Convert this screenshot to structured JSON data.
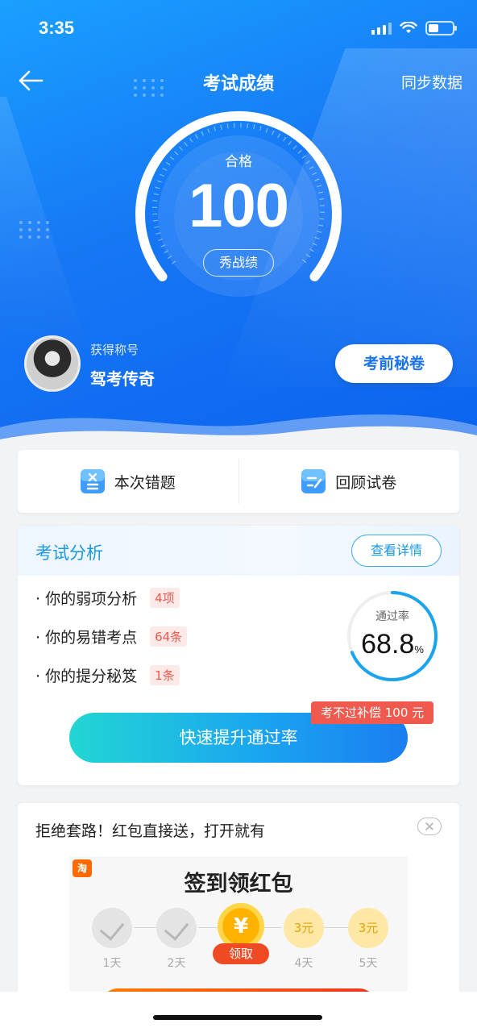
{
  "status": {
    "time": "3:35"
  },
  "nav": {
    "title": "考试成绩",
    "sync": "同步数据"
  },
  "score": {
    "level": "合格",
    "value": "100",
    "share": "秀战绩"
  },
  "user": {
    "title_label": "获得称号",
    "title_name": "驾考传奇",
    "secret_button": "考前秘卷"
  },
  "actions": [
    {
      "label": "本次错题",
      "icon": "wrong-questions-icon"
    },
    {
      "label": "回顾试卷",
      "icon": "review-paper-icon"
    }
  ],
  "analysis": {
    "title": "考试分析",
    "detail_button": "查看详情",
    "items": [
      {
        "text": "· 你的弱项分析",
        "badge": "4项"
      },
      {
        "text": "· 你的易错考点",
        "badge": "64条"
      },
      {
        "text": "· 你的提分秘笈",
        "badge": "1条"
      }
    ],
    "pass_rate_label": "通过率",
    "pass_rate": "68.8",
    "pass_rate_unit": "%",
    "pass_rate_fraction": 0.688,
    "promo_badge": "考不过补偿 100 元",
    "boost_button": "快速提升通过率"
  },
  "redpack": {
    "text": "拒绝套路！红包直接送，打开就有",
    "taobao": "淘",
    "banner_title": "签到领红包",
    "days": [
      {
        "label": "1天",
        "state": "done"
      },
      {
        "label": "2天",
        "state": "done"
      },
      {
        "label": "",
        "state": "today",
        "coin": "¥",
        "action": "领取"
      },
      {
        "label": "4天",
        "state": "upcoming",
        "reward": "3元"
      },
      {
        "label": "5天",
        "state": "upcoming",
        "reward": "3元"
      }
    ]
  },
  "colors": {
    "primary": "#1677f5",
    "accent_cyan": "#22d6d3",
    "badge_red": "#f05a4e"
  }
}
